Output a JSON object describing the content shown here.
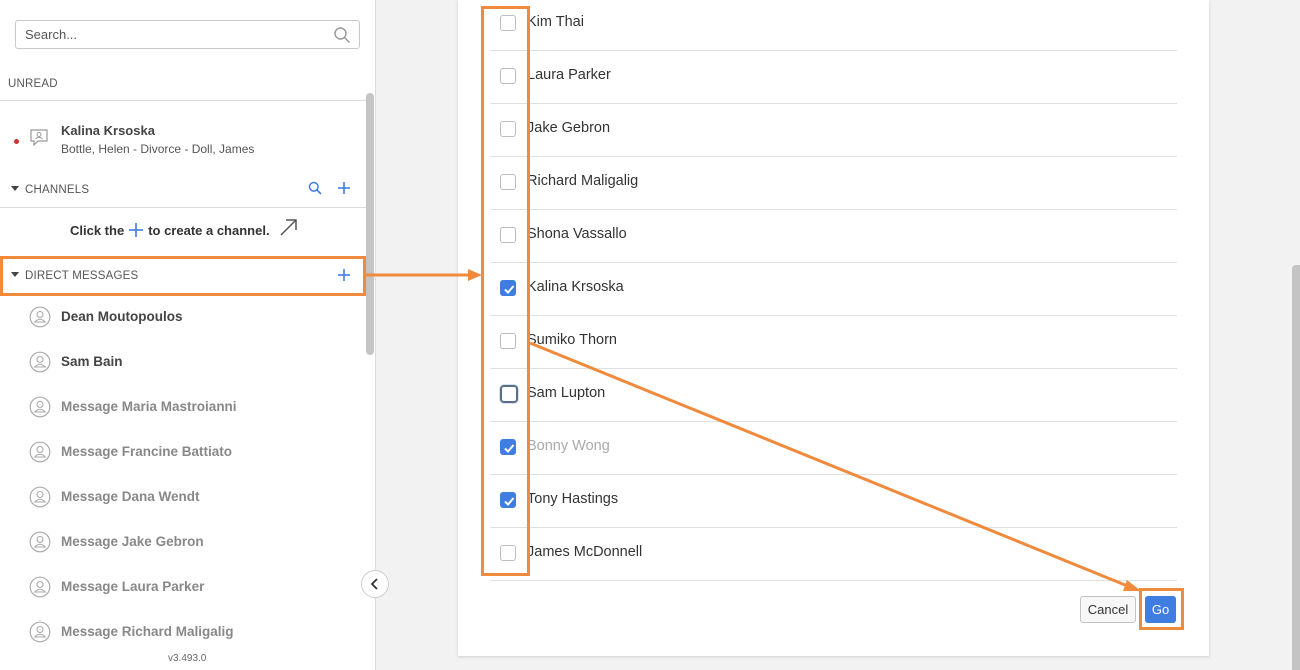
{
  "sidebar": {
    "search_placeholder": "Search...",
    "unread_label": "UNREAD",
    "unread_item": {
      "name": "Kalina Krsoska",
      "subtitle": "Bottle, Helen - Divorce - Doll, James"
    },
    "channels_label": "CHANNELS",
    "create_hint_before": "Click the",
    "create_hint_after": "to create a channel.",
    "direct_messages_label": "DIRECT MESSAGES",
    "dm_items": [
      {
        "label": "Dean Moutopoulos",
        "state": "active"
      },
      {
        "label": "Sam Bain",
        "state": "active"
      },
      {
        "label": "Message Maria Mastroianni",
        "state": "inactive"
      },
      {
        "label": "Message Francine Battiato",
        "state": "inactive"
      },
      {
        "label": "Message Dana Wendt",
        "state": "inactive"
      },
      {
        "label": "Message Jake Gebron",
        "state": "inactive"
      },
      {
        "label": "Message Laura Parker",
        "state": "inactive"
      },
      {
        "label": "Message Richard Maligalig",
        "state": "inactive"
      }
    ],
    "version": "v3.493.0",
    "icons": {
      "search": "search-icon",
      "chat": "chat-bubble-user-icon",
      "caret": "caret-down-icon",
      "plus": "plus-icon",
      "avatar": "user-avatar-icon",
      "arrow": "arrow-up-right-icon",
      "collapse": "chevron-left-icon"
    }
  },
  "dialog": {
    "members": [
      {
        "name": "Kim Thai",
        "checked": false,
        "disabled": false,
        "focused": false
      },
      {
        "name": "Laura Parker",
        "checked": false,
        "disabled": false,
        "focused": false
      },
      {
        "name": "Jake Gebron",
        "checked": false,
        "disabled": false,
        "focused": false
      },
      {
        "name": "Richard Maligalig",
        "checked": false,
        "disabled": false,
        "focused": false
      },
      {
        "name": "Shona Vassallo",
        "checked": false,
        "disabled": false,
        "focused": false
      },
      {
        "name": "Kalina Krsoska",
        "checked": true,
        "disabled": false,
        "focused": false
      },
      {
        "name": "Sumiko Thorn",
        "checked": false,
        "disabled": false,
        "focused": false
      },
      {
        "name": "Sam Lupton",
        "checked": false,
        "disabled": false,
        "focused": true
      },
      {
        "name": "Bonny Wong",
        "checked": true,
        "disabled": true,
        "focused": false
      },
      {
        "name": "Tony Hastings",
        "checked": true,
        "disabled": false,
        "focused": false
      },
      {
        "name": "James McDonnell",
        "checked": false,
        "disabled": false,
        "focused": false
      }
    ],
    "cancel_label": "Cancel",
    "go_label": "Go"
  },
  "colors": {
    "accent": "#3f7de0",
    "annotation": "#f08a3c",
    "unread_dot": "#d0312d"
  }
}
